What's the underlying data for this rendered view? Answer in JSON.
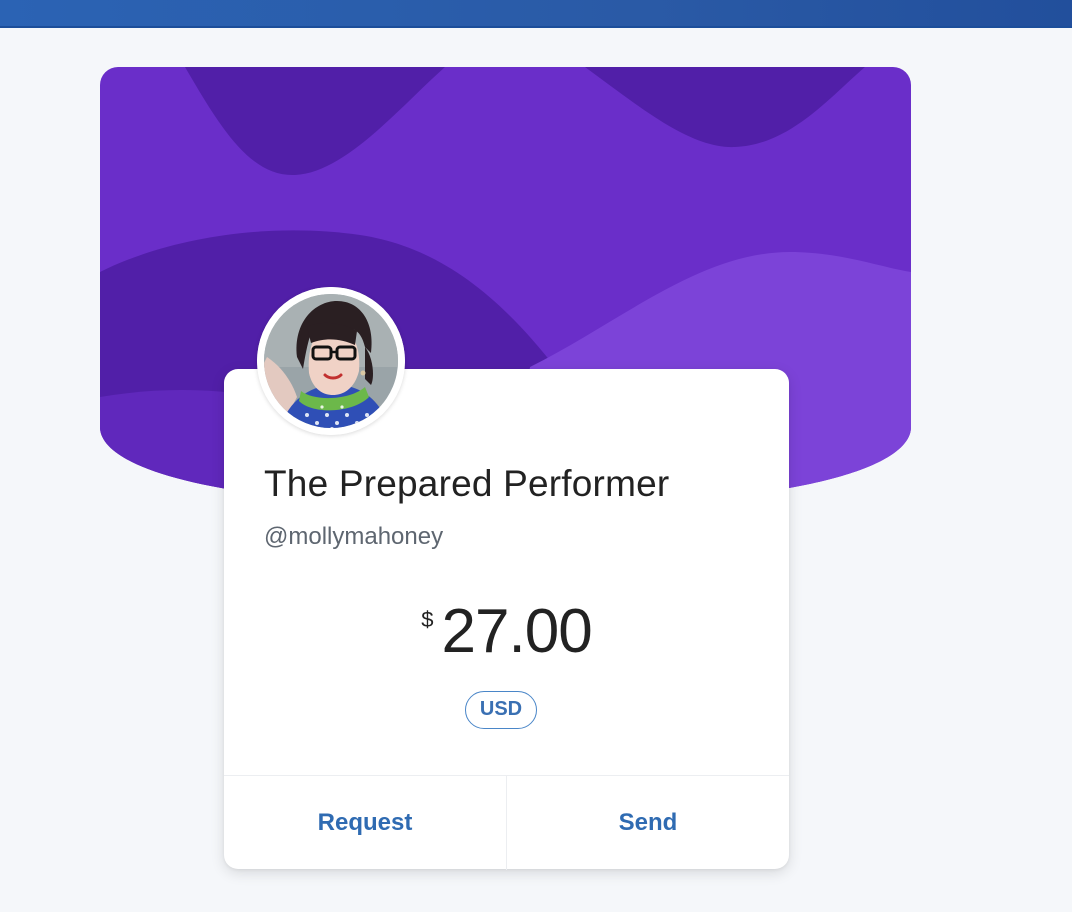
{
  "profile": {
    "name": "The Prepared Performer",
    "handle": "@mollymahoney"
  },
  "payment": {
    "currency_symbol": "$",
    "amount": "27.00",
    "currency_code": "USD"
  },
  "actions": {
    "request_label": "Request",
    "send_label": "Send"
  },
  "colors": {
    "header_bar": "#2a5aa6",
    "banner_purple": "#6a2ec9",
    "banner_dark": "#511fa8",
    "banner_light": "#7c43d8",
    "action_blue": "#2f6bb2",
    "pill_border": "#4a86c8"
  },
  "icons": {
    "avatar": "profile-photo"
  }
}
